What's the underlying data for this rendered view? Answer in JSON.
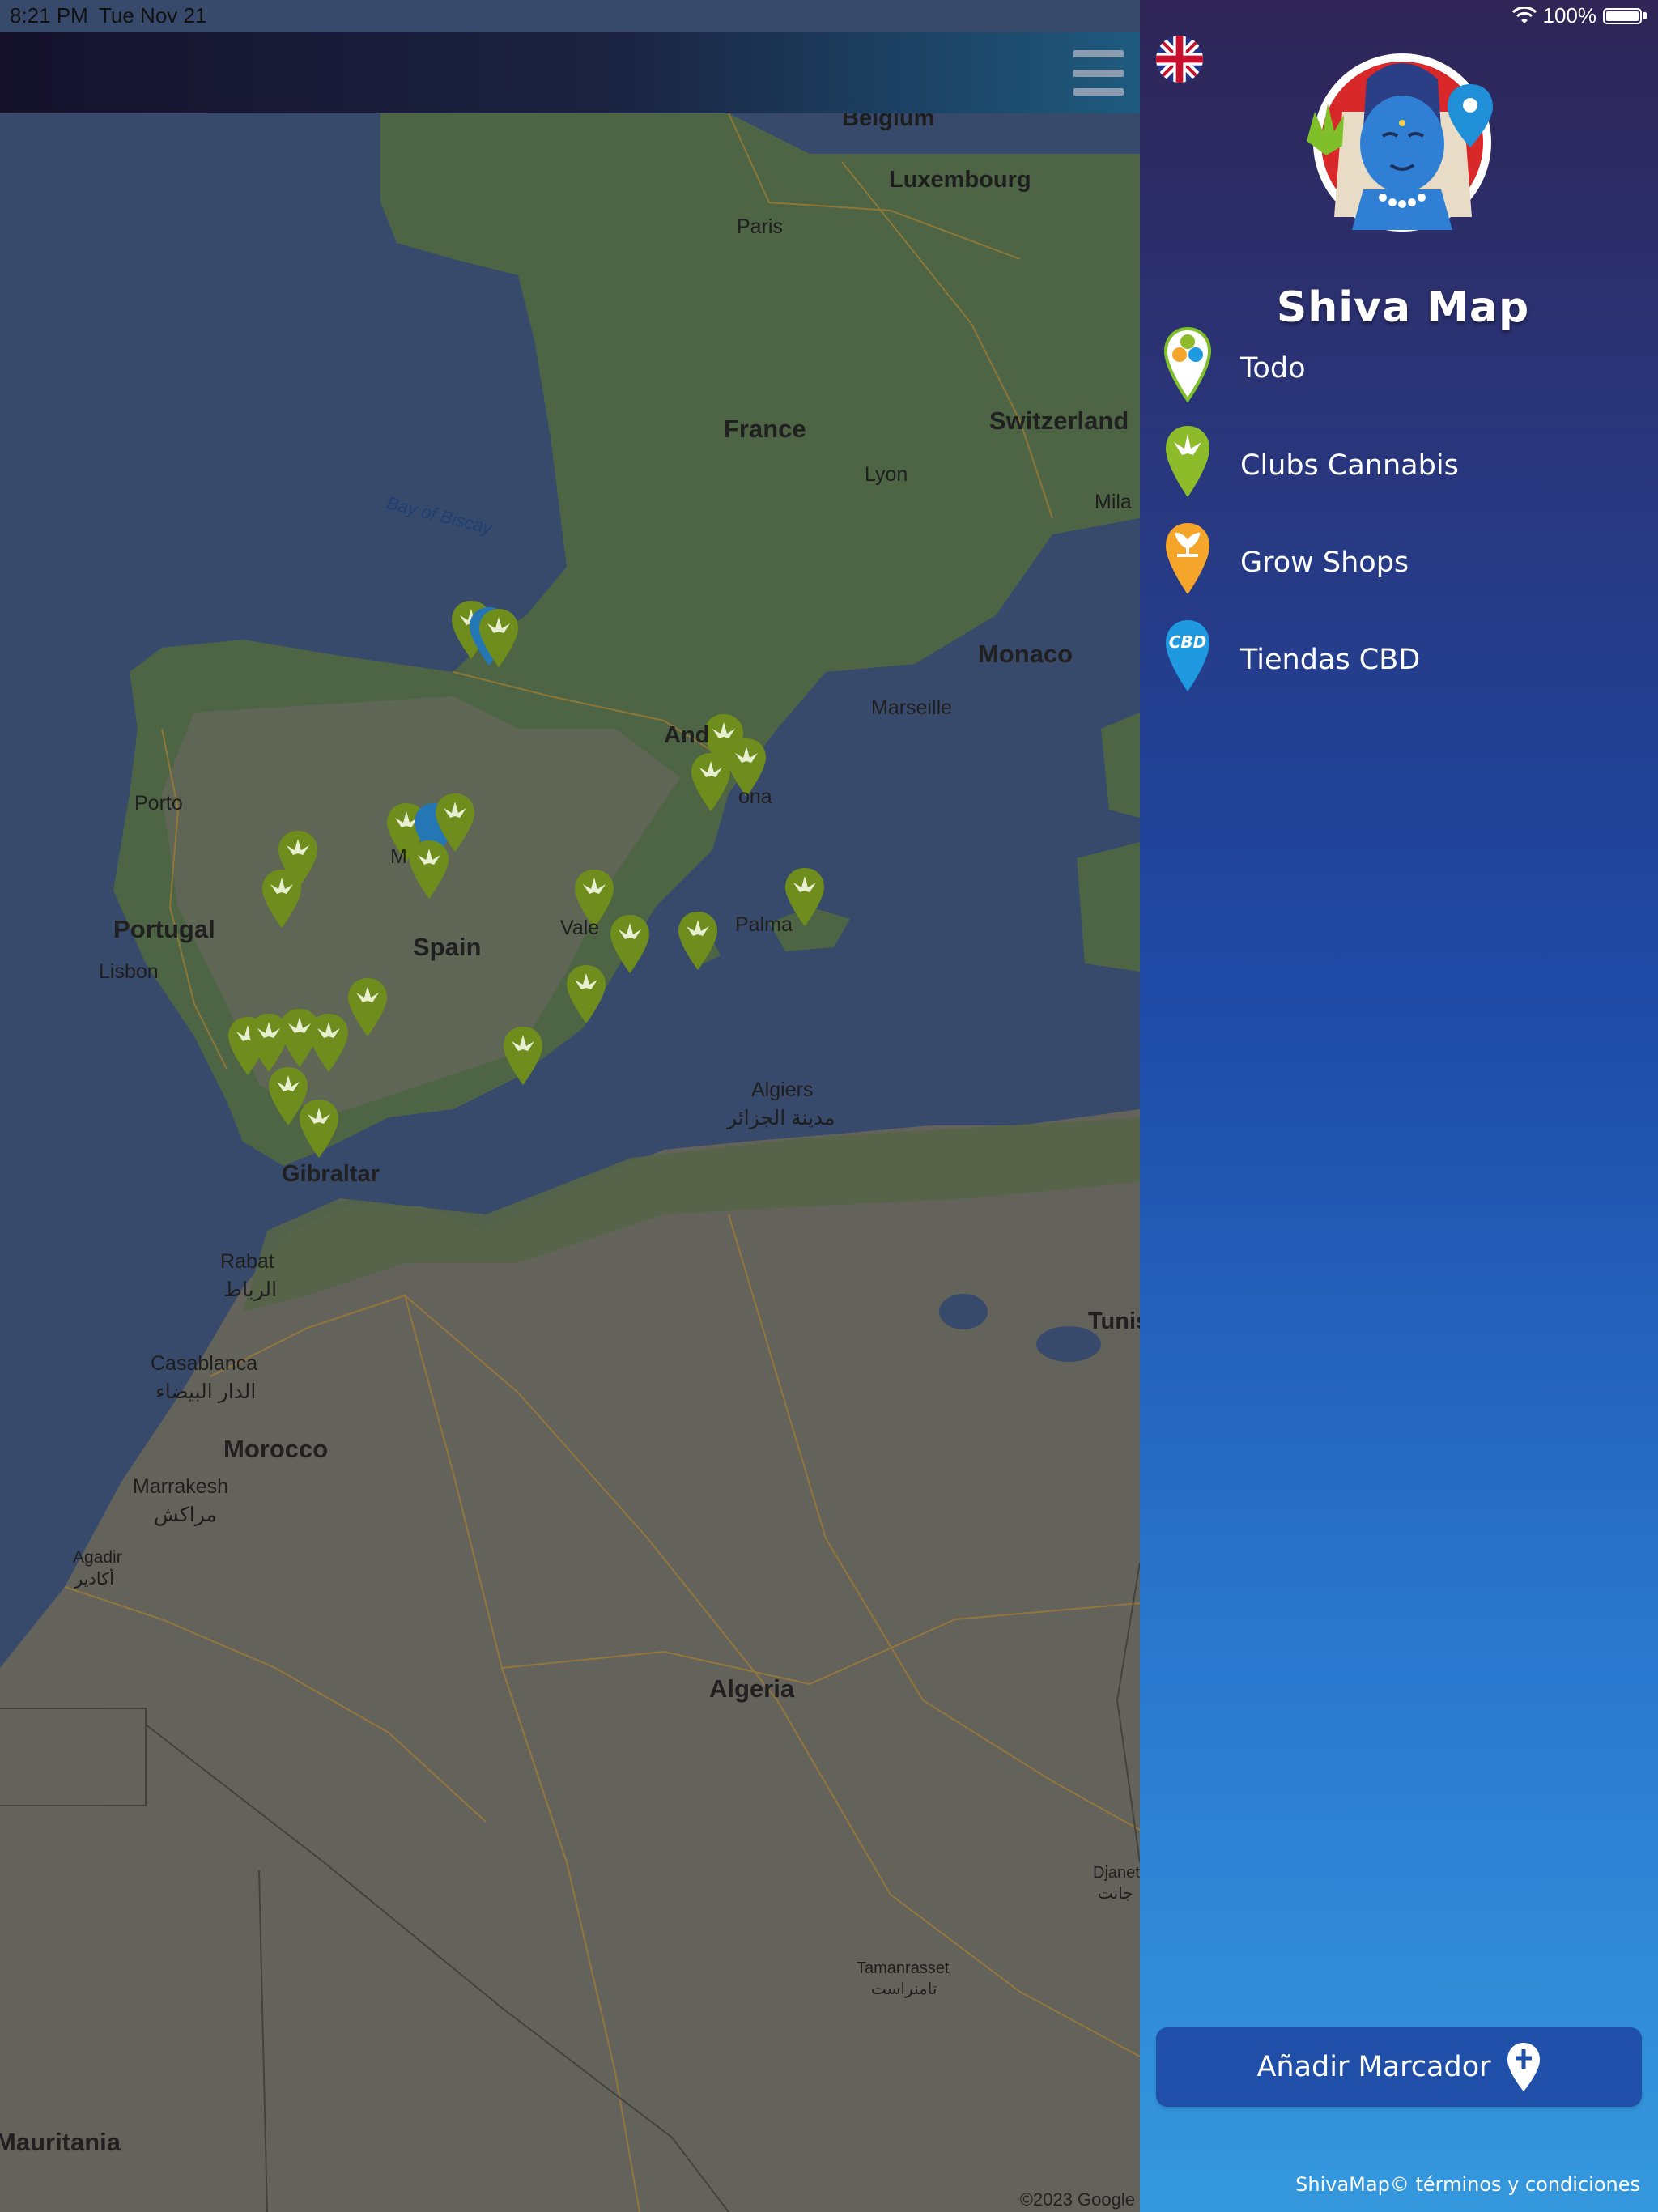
{
  "status_bar": {
    "time": "8:21 PM",
    "date": "Tue Nov 21",
    "battery": "100%",
    "wifi_icon": "wifi-icon",
    "battery_icon": "battery-icon"
  },
  "top_bar": {
    "menu_icon": "hamburger-menu-icon"
  },
  "map": {
    "copyright": "©2023 Google",
    "labels": {
      "belgium": "Belgium",
      "luxembourg": "Luxembourg",
      "paris": "Paris",
      "france": "France",
      "switzerland": "Switzerland",
      "lyon": "Lyon",
      "milan": "Mila",
      "bay_of_biscay": "Bay of Biscay",
      "monaco": "Monaco",
      "marseille": "Marseille",
      "andorra": "And",
      "barcelona": "ona",
      "porto": "Porto",
      "madrid": "M",
      "portugal": "Portugal",
      "spain": "Spain",
      "valencia": "Vale",
      "palma": "Palma",
      "lisbon": "Lisbon",
      "algiers": "Algiers",
      "algiers_ar": "مدينة الجزائر",
      "gibraltar": "Gibraltar",
      "rabat": "Rabat",
      "rabat_ar": "الرباط",
      "tunis": "Tunis",
      "casablanca": "Casablanca",
      "casablanca_ar": "الدار البيضاء",
      "morocco": "Morocco",
      "marrakesh": "Marrakesh",
      "marrakesh_ar": "مراكش",
      "agadir": "Agadir",
      "agadir_ar": "أكادير",
      "algeria": "Algeria",
      "djanet": "Djanet",
      "djanet_ar": "جانت",
      "tamanrasset": "Tamanrasset",
      "tamanrasset_ar": "تامنراست",
      "mauritania": "Mauritania"
    }
  },
  "drawer": {
    "language_flag_icon": "uk-flag-icon",
    "logo_text": "Shiva Map",
    "menu": [
      {
        "label": "Todo",
        "icon": "all-categories-pin-icon"
      },
      {
        "label": "Clubs Cannabis",
        "icon": "cannabis-club-pin-icon"
      },
      {
        "label": "Grow Shops",
        "icon": "grow-shop-pin-icon"
      },
      {
        "label": "Tiendas CBD",
        "icon": "cbd-shop-pin-icon",
        "badge": "CBD"
      }
    ],
    "add_button": "Añadir Marcador",
    "footer": "ShivaMap© términos y condiciones"
  },
  "colors": {
    "drawer_top": "#2f2556",
    "drawer_bottom": "#3598dd",
    "cannabis_green": "#8dbb2a",
    "grow_orange": "#f4a52a",
    "cbd_blue": "#1f9ae0",
    "add_button": "#1f4fa8"
  }
}
